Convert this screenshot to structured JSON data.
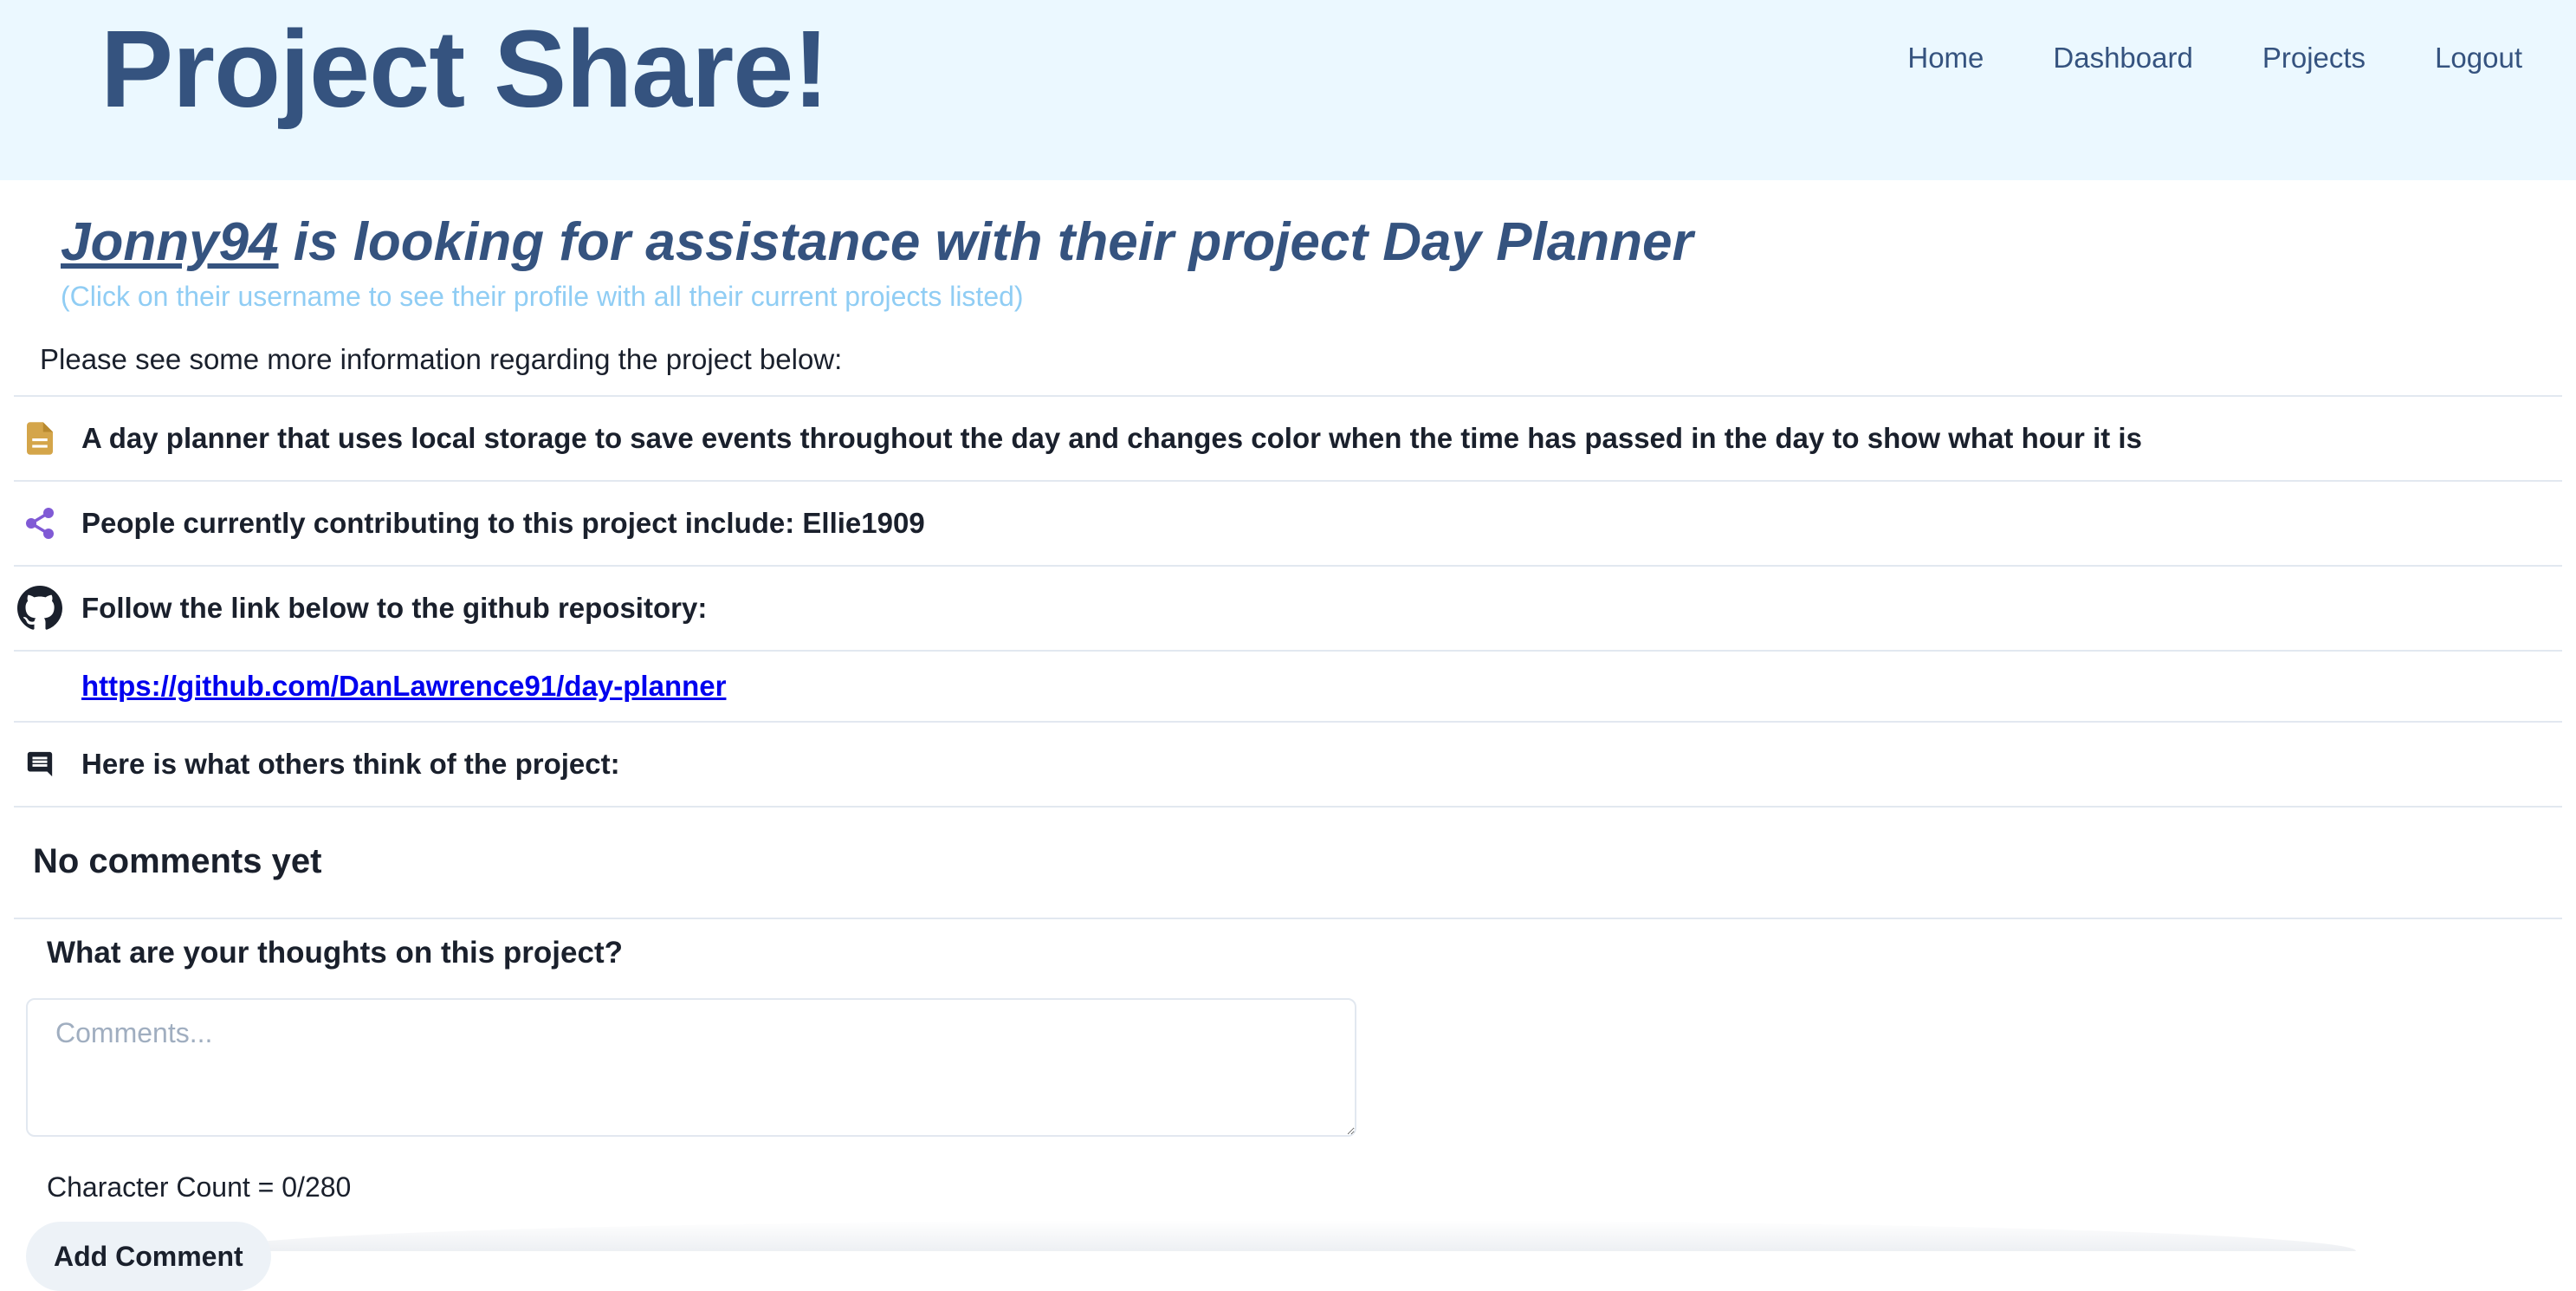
{
  "header": {
    "brand": "Project Share!",
    "nav": [
      "Home",
      "Dashboard",
      "Projects",
      "Logout"
    ]
  },
  "project": {
    "username": "Jonny94",
    "headline_rest": " is looking for assistance with their project Day Planner",
    "hint": "(Click on their username to see their profile with all their current projects listed)",
    "intro": "Please see some more information regarding the project below:",
    "description": "A day planner that uses local storage to save events throughout the day and changes color when the time has passed in the day to show what hour it is",
    "contributors": "People currently contributing to this project include: Ellie1909",
    "github_prompt": "Follow the link below to the github repository:",
    "repo_url": "https://github.com/DanLawrence91/day-planner",
    "comments_prompt": "Here is what others think of the project:"
  },
  "comments": {
    "empty_message": "No comments yet",
    "form_title": "What are your thoughts on this project?",
    "placeholder": "Comments...",
    "value": "",
    "char_count": "Character Count = 0/280",
    "submit_label": "Add Comment"
  },
  "icons": {
    "description": "document-icon",
    "contributors": "share-icon",
    "github": "github-icon",
    "comments": "comment-icon"
  },
  "colors": {
    "header_bg": "#ebf8ff",
    "brand": "#35537f",
    "hint": "#90cdf4",
    "document_icon": "#d4a54a",
    "share_icon": "#805ad5",
    "link": "#0000ee"
  }
}
